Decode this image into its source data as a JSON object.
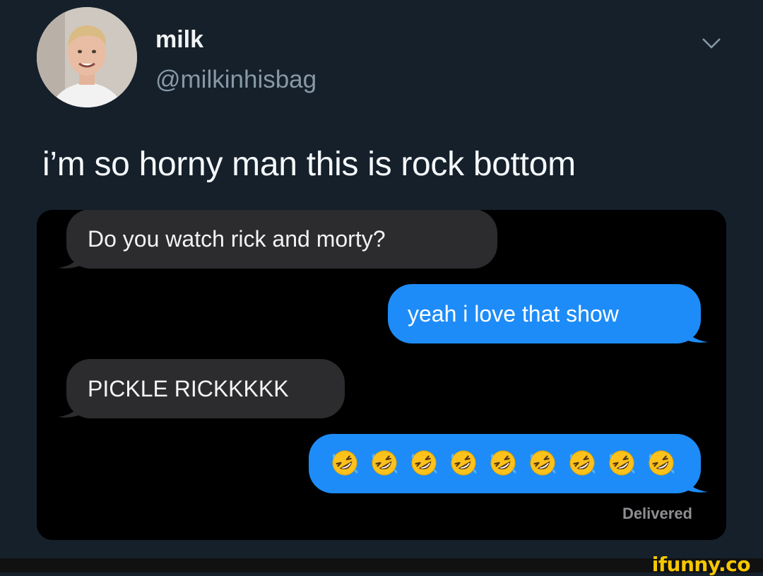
{
  "tweet": {
    "author": {
      "display_name": "milk",
      "handle": "@milkinhisbag"
    },
    "text": "i’m so horny man this is rock bottom"
  },
  "chat": {
    "messages": [
      {
        "direction": "incoming",
        "text": "Do you watch rick and morty?"
      },
      {
        "direction": "outgoing",
        "text": "yeah i love that show"
      },
      {
        "direction": "incoming",
        "text": "PICKLE RICKKKKK"
      },
      {
        "direction": "outgoing",
        "text": "",
        "emoji": "rolling-on-floor-laughing",
        "emoji_count": 9
      }
    ],
    "status": "Delivered"
  },
  "watermark": "ifunny.co",
  "colors": {
    "background": "#15202b",
    "incoming_bubble": "#2c2c2e",
    "outgoing_bubble": "#1d8cf8",
    "watermark": "#f7c800"
  },
  "icons": {
    "menu": "chevron-down-icon",
    "emoji": "rolling-on-floor-laughing-icon"
  }
}
